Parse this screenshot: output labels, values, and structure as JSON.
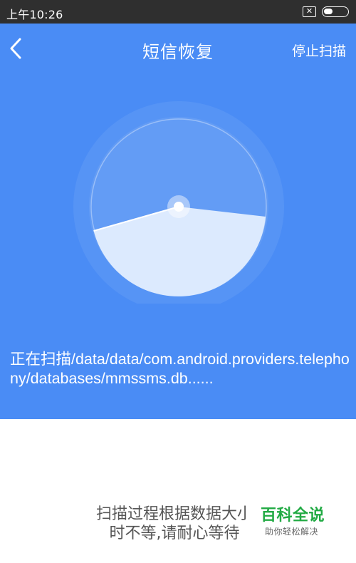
{
  "status_bar": {
    "time": "上午10:26",
    "sim_icon": "sim-card-slashed-icon",
    "battery_icon": "battery-icon"
  },
  "header": {
    "back_icon": "chevron-left-icon",
    "title": "短信恢复",
    "stop_scan_label": "停止扫描"
  },
  "scan": {
    "status_text": "正在扫描/data/data/com.android.providers.telephony/databases/mmssms.db......"
  },
  "hint": {
    "text": "扫描过程根据数据大小时不等,请耐心等待",
    "line1": "扫描过程根据数据大小",
    "line2": "时不等,请耐心等待"
  },
  "watermark": {
    "brand": "百科全说",
    "tagline": "助你轻松解决"
  },
  "colors": {
    "status_bar_bg": "#2f2f2f",
    "scan_panel_bg": "#4a8cf5",
    "radar_sector": "#dceafe",
    "watermark_green": "#22aa44"
  }
}
